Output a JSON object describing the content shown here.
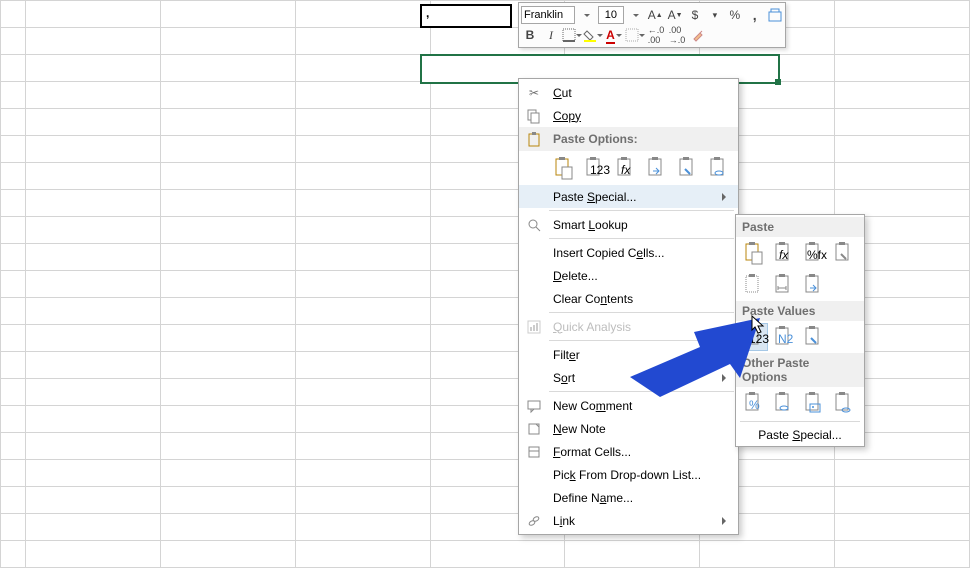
{
  "cell_value": ",",
  "mini": {
    "font": "Franklin",
    "size": "10",
    "dollar": "$",
    "pct": "%"
  },
  "menu": {
    "cut": "Cut",
    "copy": "Copy",
    "paste_options": "Paste Options:",
    "paste_special": "Paste Special...",
    "smart": "Smart Lookup",
    "insert": "Insert Copied Cells...",
    "delete": "Delete...",
    "clear": "Clear Contents",
    "quick": "Quick Analysis",
    "filter": "Filter",
    "sort": "Sort",
    "comment": "New Comment",
    "note": "New Note",
    "format": "Format Cells...",
    "pick": "Pick From Drop-down List...",
    "define": "Define Name...",
    "link": "Link"
  },
  "sub": {
    "paste": "Paste",
    "values": "Paste Values",
    "other": "Other Paste Options",
    "special": "Paste Special..."
  },
  "p123": "123",
  "p_perc": "%",
  "pfx": "fx",
  "p%fx": "%fx",
  "pN2": "N2"
}
